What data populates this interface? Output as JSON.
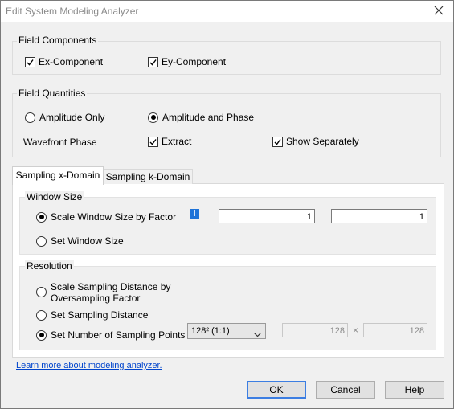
{
  "window": {
    "title": "Edit System Modeling Analyzer",
    "close_icon": "close-icon"
  },
  "field_components": {
    "title": "Field Components",
    "ex": {
      "label": "Ex-Component",
      "checked": true
    },
    "ey": {
      "label": "Ey-Component",
      "checked": true
    }
  },
  "field_quantities": {
    "title": "Field Quantities",
    "amplitude_only": {
      "label": "Amplitude Only",
      "selected": false
    },
    "amplitude_phase": {
      "label": "Amplitude and Phase",
      "selected": true
    },
    "wavefront_label": "Wavefront Phase",
    "extract": {
      "label": "Extract",
      "checked": true
    },
    "show_separately": {
      "label": "Show Separately",
      "checked": true
    }
  },
  "tabs": [
    {
      "label": "Sampling x-Domain",
      "active": true
    },
    {
      "label": "Sampling k-Domain",
      "active": false
    }
  ],
  "window_size": {
    "title": "Window Size",
    "scale": {
      "label": "Scale Window Size by Factor",
      "selected": true
    },
    "set": {
      "label": "Set Window Size",
      "selected": false
    },
    "factor_x": "1",
    "factor_y": "1",
    "info_icon": "info-icon"
  },
  "resolution": {
    "title": "Resolution",
    "oversampling": {
      "label_line1": "Scale Sampling Distance by",
      "label_line2": "Oversampling Factor",
      "selected": false
    },
    "distance": {
      "label": "Set Sampling Distance",
      "selected": false
    },
    "points": {
      "label": "Set Number of Sampling Points",
      "selected": true
    },
    "points_select": "128² (1:1)",
    "points_x": "128",
    "times": "×",
    "points_y": "128"
  },
  "footer": {
    "link": "Learn more about modeling analyzer.",
    "ok": "OK",
    "cancel": "Cancel",
    "help": "Help"
  },
  "colors": {
    "link": "#0044cc",
    "accent": "#3c7ee2",
    "info": "#1e73d8"
  }
}
